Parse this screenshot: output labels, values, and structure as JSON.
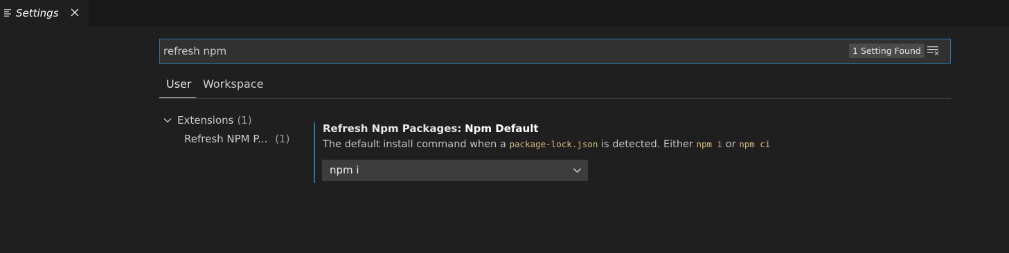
{
  "tab": {
    "title": "Settings",
    "icon": "settings-editor-icon",
    "close_icon": "close-icon"
  },
  "search": {
    "value": "refresh npm",
    "placeholder": "Search settings",
    "result_count": "1 Setting Found",
    "clear_icon": "clear-filter-icon"
  },
  "scope_tabs": [
    {
      "label": "User",
      "active": true
    },
    {
      "label": "Workspace",
      "active": false
    }
  ],
  "toc": {
    "group": {
      "label": "Extensions",
      "count": "(1)"
    },
    "item": {
      "label": "Refresh NPM P...",
      "count": "(1)"
    }
  },
  "setting": {
    "category": "Refresh Npm Packages:",
    "name": "Npm Default",
    "desc_part1": "The default install command when a",
    "desc_code1": "package-lock.json",
    "desc_part2": "is detected. Either",
    "desc_code2": "npm i",
    "desc_part3": "or",
    "desc_code3": "npm ci",
    "selected_value": "npm i"
  },
  "colors": {
    "background": "#1f1f1f",
    "focus_border": "#2b79a8",
    "code_text": "#d7ba7d",
    "input_background": "#313131"
  }
}
